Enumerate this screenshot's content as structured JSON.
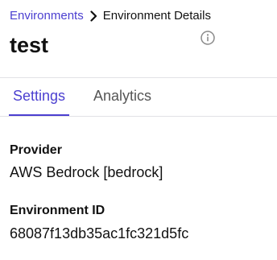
{
  "breadcrumb": {
    "parent_label": "Environments",
    "current_label": "Environment Details",
    "separator_icon": "chevron-right-icon"
  },
  "header": {
    "title": "test",
    "info_icon": "info-icon"
  },
  "tabs": [
    {
      "label": "Settings",
      "active": true
    },
    {
      "label": "Analytics",
      "active": false
    }
  ],
  "settings": {
    "provider": {
      "label": "Provider",
      "value": "AWS Bedrock [bedrock]"
    },
    "environment_id": {
      "label": "Environment ID",
      "value": "68087f13db35ac1fc321d5fc"
    }
  },
  "colors": {
    "accent": "#4b3fd0",
    "text": "#111111",
    "muted": "#555555",
    "divider": "#e2e2e6"
  }
}
